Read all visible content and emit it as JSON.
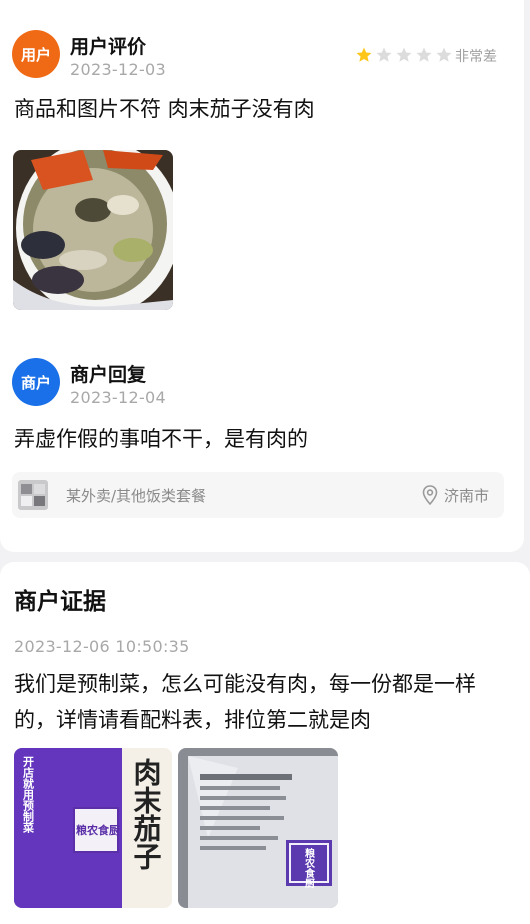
{
  "review": {
    "avatar_text": "用户",
    "name": "用户评价",
    "date": "2023-12-03",
    "rating": 1,
    "rating_max": 5,
    "rating_label": "非常差",
    "text": "商品和图片不符 肉末茄子没有肉",
    "star_on_color": "#ffc61a",
    "star_off_color": "#dcdcdc"
  },
  "reply": {
    "avatar_text": "商户",
    "name": "商户回复",
    "date": "2023-12-04",
    "text": "弄虚作假的事咱不干，是有肉的"
  },
  "store": {
    "text": "某外卖/其他饭类套餐",
    "location": "济南市"
  },
  "evidence": {
    "title": "商户证据",
    "time": "2023-12-06 10:50:35",
    "text": "我们是预制菜，怎么可能没有肉，每一份都是一样的，详情请看配料表，排位第二就是肉",
    "pack_front_text": "肉末茄子",
    "pack_brand": "粮农食厨",
    "pack_side_text": "开店就用预制菜"
  }
}
